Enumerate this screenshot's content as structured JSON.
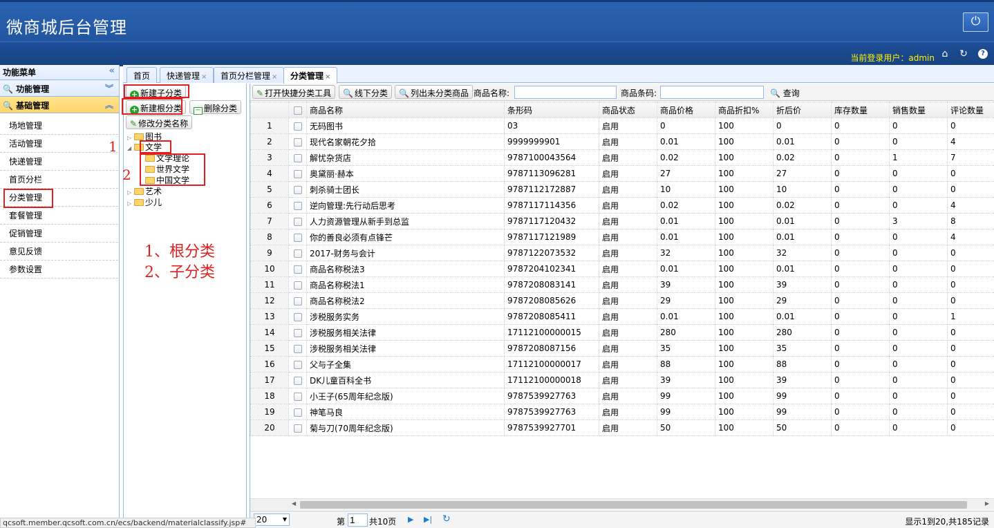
{
  "header": {
    "title": "微商城后台管理",
    "user_label": "当前登录用户：admin"
  },
  "sidebar": {
    "title": "功能菜单",
    "sections": [
      {
        "label": "功能管理"
      },
      {
        "label": "基础管理"
      }
    ],
    "items": [
      {
        "label": "场地管理"
      },
      {
        "label": "活动管理"
      },
      {
        "label": "快递管理"
      },
      {
        "label": "首页分栏"
      },
      {
        "label": "分类管理"
      },
      {
        "label": "套餐管理"
      },
      {
        "label": "促销管理"
      },
      {
        "label": "意见反馈"
      },
      {
        "label": "参数设置"
      }
    ]
  },
  "tabs": [
    {
      "label": "首页"
    },
    {
      "label": "快递管理"
    },
    {
      "label": "首页分栏管理"
    },
    {
      "label": "分类管理"
    }
  ],
  "tree": {
    "btn_new_child": "新建子分类",
    "btn_new_root": "新建根分类",
    "btn_delete": "删除分类",
    "btn_rename": "修改分类名称",
    "nodes": [
      {
        "label": "图书"
      },
      {
        "label": "文学"
      },
      {
        "label": "文学理论"
      },
      {
        "label": "世界文学"
      },
      {
        "label": "中国文学"
      },
      {
        "label": "艺术"
      },
      {
        "label": "少儿"
      }
    ]
  },
  "annotations": {
    "n1": "1",
    "n2": "2",
    "line1": "1、根分类",
    "line2": "2、子分类"
  },
  "toolbar": {
    "open_tool": "打开快捷分类工具",
    "offline": "线下分类",
    "list_unclassified": "列出未分类商品",
    "name_label": "商品名称:",
    "code_label": "商品条码:",
    "query": "查询"
  },
  "table": {
    "headers": [
      "商品名称",
      "条形码",
      "商品状态",
      "商品价格",
      "商品折扣%",
      "折后价",
      "库存数量",
      "销售数量",
      "评论数量"
    ],
    "rows": [
      [
        "1",
        "无码图书",
        "03",
        "启用",
        "0",
        "100",
        "0",
        "0",
        "0",
        "0"
      ],
      [
        "2",
        "现代名家朝花夕拾",
        "9999999901",
        "启用",
        "0.01",
        "100",
        "0.01",
        "0",
        "0",
        "4"
      ],
      [
        "3",
        "解忧杂货店",
        "9787100043564",
        "启用",
        "0.02",
        "100",
        "0.02",
        "0",
        "1",
        "7"
      ],
      [
        "4",
        "奥黛丽·赫本",
        "9787113096281",
        "启用",
        "27",
        "100",
        "27",
        "0",
        "0",
        "0"
      ],
      [
        "5",
        "刺杀骑士团长",
        "9787112172887",
        "启用",
        "10",
        "100",
        "10",
        "0",
        "0",
        "0"
      ],
      [
        "6",
        "逆向管理:先行动后思考",
        "9787117114356",
        "启用",
        "0.02",
        "100",
        "0.02",
        "0",
        "0",
        "4"
      ],
      [
        "7",
        "人力资源管理从新手到总监",
        "9787117120432",
        "启用",
        "0.01",
        "100",
        "0.01",
        "0",
        "3",
        "8"
      ],
      [
        "8",
        "你的善良必须有点锋芒",
        "9787117121989",
        "启用",
        "0.01",
        "100",
        "0.01",
        "0",
        "0",
        "4"
      ],
      [
        "9",
        "2017-财务与会计",
        "9787122073532",
        "启用",
        "32",
        "100",
        "32",
        "0",
        "0",
        "0"
      ],
      [
        "10",
        "商品名称税法3",
        "9787204102341",
        "启用",
        "0.01",
        "100",
        "0.01",
        "0",
        "0",
        "0"
      ],
      [
        "11",
        "商品名称税法1",
        "9787208083141",
        "启用",
        "39",
        "100",
        "39",
        "0",
        "0",
        "0"
      ],
      [
        "12",
        "商品名称税法2",
        "9787208085626",
        "启用",
        "29",
        "100",
        "29",
        "0",
        "0",
        "0"
      ],
      [
        "13",
        "涉税服务实务",
        "9787208085411",
        "启用",
        "0.01",
        "100",
        "0.01",
        "0",
        "0",
        "1"
      ],
      [
        "14",
        "涉税服务相关法律",
        "17112100000015",
        "启用",
        "280",
        "100",
        "280",
        "0",
        "0",
        "0"
      ],
      [
        "15",
        "涉税服务相关法律",
        "9787208087156",
        "启用",
        "35",
        "100",
        "35",
        "0",
        "0",
        "0"
      ],
      [
        "16",
        "父与子全集",
        "17112100000017",
        "启用",
        "88",
        "100",
        "88",
        "0",
        "0",
        "0"
      ],
      [
        "17",
        "DK儿童百科全书",
        "17112100000018",
        "启用",
        "39",
        "100",
        "39",
        "0",
        "0",
        "0"
      ],
      [
        "18",
        "小王子(65周年纪念版)",
        "9787539927763",
        "启用",
        "99",
        "100",
        "99",
        "0",
        "0",
        "0"
      ],
      [
        "19",
        "神笔马良",
        "9787539927763",
        "启用",
        "99",
        "100",
        "99",
        "0",
        "0",
        "0"
      ],
      [
        "20",
        "菊与刀(70周年纪念版)",
        "9787539927701",
        "启用",
        "50",
        "100",
        "50",
        "0",
        "0",
        "0"
      ]
    ]
  },
  "pager": {
    "page_size": "20",
    "page_prefix": "第",
    "page_value": "1",
    "page_total": "共10页",
    "summary": "显示1到20,共185记录"
  },
  "status_bar": "qcsoft.member.qcsoft.com.cn/ecs/backend/materialclassify.jsp#"
}
